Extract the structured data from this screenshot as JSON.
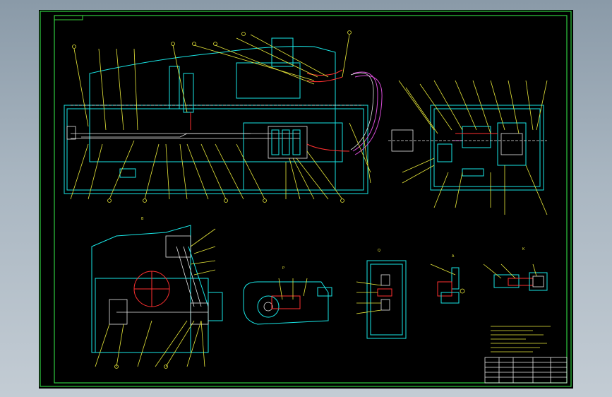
{
  "title_block": {
    "header_tag": "",
    "table_rows": [
      "",
      "",
      "",
      "",
      ""
    ],
    "drawing_title": "",
    "sheet_code": ""
  },
  "view_labels": {
    "top_right_section": "",
    "detail_b": "B",
    "detail_p": "P",
    "detail_q": "Q",
    "detail_a": "A",
    "detail_k": "K"
  },
  "notes": {
    "heading": "",
    "lines": [
      "",
      "",
      "",
      "",
      "",
      "",
      "",
      ""
    ]
  },
  "colors": {
    "background": "#000000",
    "frame": "#2ecc40",
    "outline": "#19e6e6",
    "leader": "#e8e83a",
    "pipe_red": "#ff3030",
    "pipe_magenta": "#d94dd9",
    "white": "#e6e6e6"
  },
  "callouts": [
    "",
    "",
    "",
    "",
    "",
    "",
    "",
    "",
    "",
    "",
    "",
    "",
    "",
    "",
    "",
    "",
    "",
    "",
    "",
    "",
    "",
    "",
    "",
    "",
    "",
    "",
    "",
    "",
    "",
    ""
  ]
}
